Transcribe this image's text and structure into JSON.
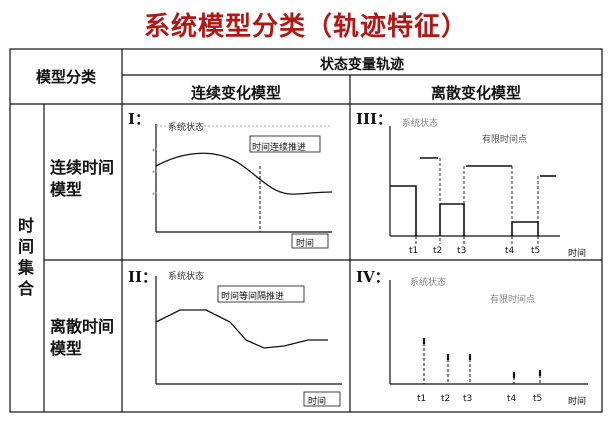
{
  "title": "系统模型分类（轨迹特征）",
  "header": {
    "model_class": "模型分类",
    "state_trajectory": "状态变量轨迹",
    "continuous_change": "连续变化模型",
    "discrete_change": "离散变化模型"
  },
  "rows": {
    "discrete_time_set": "时间集合",
    "continuous_time_model": "连续时间模型",
    "discrete_time_model": "离散时间模型"
  },
  "panels": {
    "p1": {
      "roman": "I：",
      "state_label": "系统状态",
      "annotation": "时间连续推进",
      "time_label": "时间"
    },
    "p2": {
      "roman": "II：",
      "state_label": "系统状态",
      "annotation": "时间等间隔推进",
      "time_label": "时间"
    },
    "p3": {
      "roman": "III：",
      "state_label": "系统状态",
      "annotation": "有限时间点",
      "time_label": "时间",
      "ticks": [
        "t1",
        "t2",
        "t3",
        "t4",
        "t5"
      ]
    },
    "p4": {
      "roman": "IV：",
      "state_label": "系统状态",
      "annotation": "有限时间点",
      "time_label": "时间",
      "ticks": [
        "t1",
        "t2",
        "t3",
        "t4",
        "t5"
      ]
    }
  },
  "colors": {
    "title": "#b01818",
    "line": "#111111",
    "grid": "#444444"
  }
}
